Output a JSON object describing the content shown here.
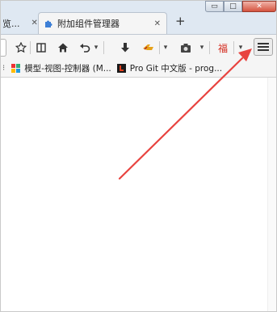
{
  "tabs": [
    {
      "title": "览...",
      "close": "✕",
      "active": false
    },
    {
      "title": "附加组件管理器",
      "close": "✕",
      "active": true
    }
  ],
  "new_tab_label": "+",
  "window_controls": {
    "minimize": "▭",
    "maximize": "□",
    "close": "✕"
  },
  "toolbar": {
    "icons": [
      "star-icon",
      "reading-list-icon",
      "home-icon",
      "back-history-icon",
      "download-icon",
      "addon-icon",
      "screenshot-icon",
      "fortune-icon",
      "dropdown-icon",
      "menu-icon"
    ],
    "dropdown": "▾"
  },
  "bookmarks": [
    {
      "label": "模型-视图-控制器 (M..."
    },
    {
      "label": "Pro Git 中文版 - prog..."
    }
  ],
  "colors": {
    "arrow": "#e8433f",
    "pro_git_icon_bg": "#1a1a1a",
    "pro_git_icon_fg": "#e0401f"
  }
}
